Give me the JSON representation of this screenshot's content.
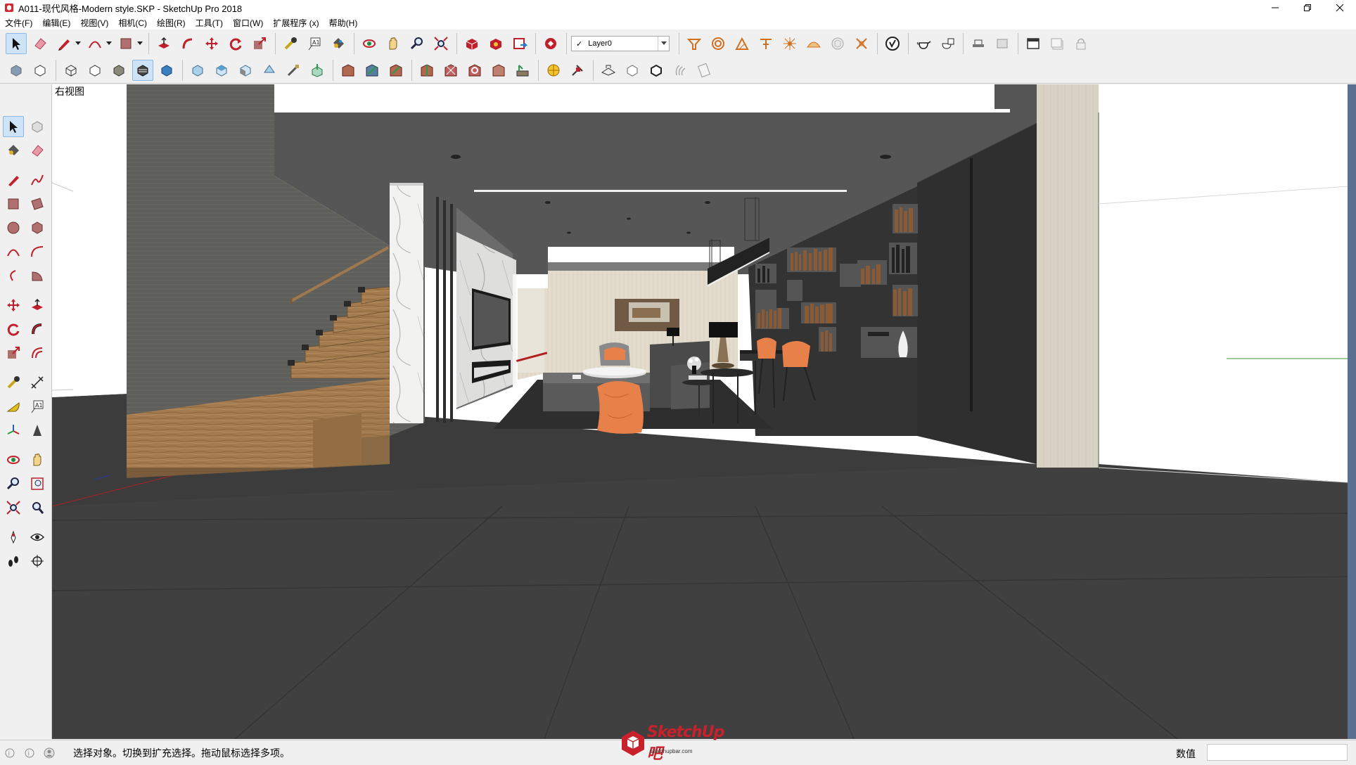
{
  "window": {
    "title": "A011-现代风格-Modern style.SKP - SketchUp Pro 2018",
    "controls": [
      "minimize",
      "restore",
      "close"
    ]
  },
  "menu": {
    "items": [
      "文件(F)",
      "编辑(E)",
      "视图(V)",
      "相机(C)",
      "绘图(R)",
      "工具(T)",
      "窗口(W)",
      "扩展程序 (x)",
      "帮助(H)"
    ]
  },
  "toolbar": {
    "layer_value": "Layer0",
    "row1_icons": [
      "select-icon",
      "eraser-icon",
      "pencil-icon",
      "arc-icon",
      "rectangle-icon",
      "push-pull-icon",
      "follow-me-icon",
      "move-icon",
      "rotate-icon",
      "scale-icon",
      "tape-measure-icon",
      "text-icon",
      "paint-bucket-icon",
      "orbit-icon",
      "pan-icon",
      "zoom-icon",
      "zoom-extents-icon",
      "3d-warehouse-icon",
      "extension-warehouse-icon",
      "layout-icon",
      "extension-manager-icon",
      "sandbox-from-contours-icon",
      "sandbox-from-scratch-icon",
      "smoove-icon",
      "stamp-icon",
      "drape-icon",
      "add-detail-icon",
      "flip-edge-icon",
      "solid-inspector-icon",
      "vray-icon",
      "teapot-icon",
      "render-icon",
      "section-plane-icon",
      "section-display-icon",
      "scenes-icon",
      "views-icon",
      "lock-icon"
    ],
    "row2_icons": [
      "xray-icon",
      "back-edges-icon",
      "wireframe-icon",
      "hidden-line-icon",
      "shaded-icon",
      "shaded-textures-icon",
      "monochrome-icon",
      "iso-view-icon",
      "top-view-icon",
      "front-view-icon",
      "right-view-icon",
      "back-view-icon",
      "left-view-icon",
      "outer-shell-icon",
      "intersect-icon",
      "union-icon",
      "subtract-icon",
      "trim-icon",
      "split-icon",
      "sun-icon",
      "component-tool-icon",
      "shadows-icon",
      "fog-icon",
      "match-photo-icon",
      "edge-style-icon",
      "face-style-icon"
    ]
  },
  "left_toolbar": {
    "icons": [
      [
        "select-icon",
        "component-icon"
      ],
      [
        "paint-bucket-icon",
        "eraser-icon"
      ],
      [
        "line-icon",
        "freehand-icon"
      ],
      [
        "rectangle-icon",
        "rotated-rectangle-icon"
      ],
      [
        "circle-icon",
        "polygon-icon"
      ],
      [
        "arc-icon",
        "two-point-arc-icon"
      ],
      [
        "three-point-arc-icon",
        "pie-icon"
      ],
      [
        "move-icon",
        "push-pull-icon"
      ],
      [
        "rotate-icon",
        "follow-me-icon"
      ],
      [
        "scale-icon",
        "offset-icon"
      ],
      [
        "tape-measure-icon",
        "dimension-icon"
      ],
      [
        "protractor-icon",
        "text-icon"
      ],
      [
        "axes-icon",
        "3d-text-icon"
      ],
      [
        "orbit-icon",
        "pan-icon"
      ],
      [
        "zoom-icon",
        "zoom-window-icon"
      ],
      [
        "zoom-extents-icon",
        "previous-view-icon"
      ],
      [
        "position-camera-icon",
        "look-around-icon"
      ],
      [
        "walk-icon",
        "section-plane-icon"
      ]
    ]
  },
  "viewport": {
    "scene_label": "右视图",
    "colors": {
      "ceiling": "#5a5a5a",
      "floor": "#3f3f3f",
      "stair_wood": "#a07a50",
      "accent_orange": "#e8804a",
      "bookshelf_dark": "#2e2e2e"
    }
  },
  "statusbar": {
    "message": "选择对象。切换到扩充选择。拖动鼠标选择多项。",
    "measurements_label": "数值",
    "measurements_value": "",
    "icons": [
      "geo-location-icon",
      "credits-icon",
      "user-icon"
    ]
  },
  "watermark": {
    "text": "SketchUp吧",
    "sub": "sketchupbar.com"
  }
}
